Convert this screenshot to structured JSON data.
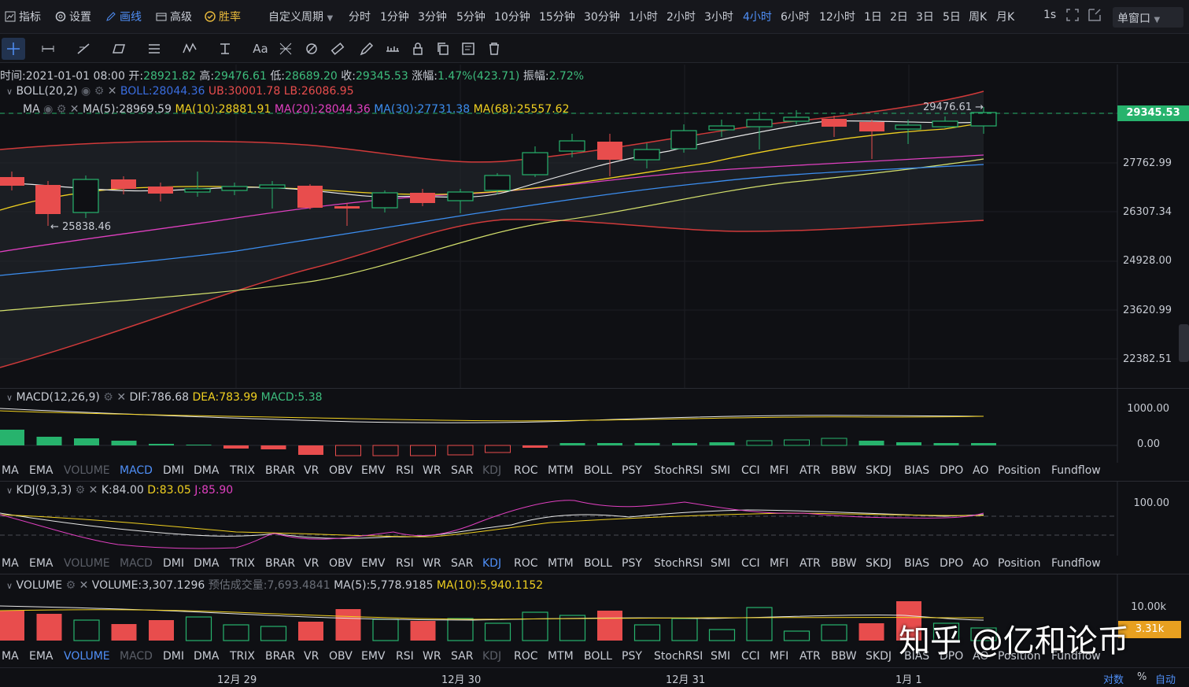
{
  "topbar": {
    "items": [
      {
        "label": "指标",
        "icon": "chart-icon"
      },
      {
        "label": "设置",
        "icon": "gear-icon"
      },
      {
        "label": "画线",
        "icon": "pen-icon",
        "active": true
      },
      {
        "label": "高级",
        "icon": "folder-icon"
      },
      {
        "label": "胜率",
        "icon": "target-icon",
        "gold": true
      }
    ],
    "custom_period": "自定义周期",
    "periods": [
      "分时",
      "1分钟",
      "3分钟",
      "5分钟",
      "10分钟",
      "15分钟",
      "30分钟",
      "1小时",
      "2小时",
      "3小时",
      "4小时",
      "6小时",
      "12小时",
      "1日",
      "2日",
      "3日",
      "5日",
      "周K",
      "月K"
    ],
    "active_period": "4小时",
    "interval_1s": "1s",
    "window_mode": "单窗口"
  },
  "main": {
    "ohlc": {
      "time_label": "时间:",
      "time": "2021-01-01 08:00",
      "open_label": "开:",
      "open": "28921.82",
      "high_label": "高:",
      "high": "29476.61",
      "low_label": "低:",
      "low": "28689.20",
      "close_label": "收:",
      "close": "29345.53",
      "change_label": "涨幅:",
      "change": "1.47%(423.71)",
      "amp_label": "振幅:",
      "amp": "2.72%"
    },
    "boll": {
      "name": "BOLL(20,2)",
      "mid": "BOLL:28044.36",
      "ub": "UB:30001.78",
      "lb": "LB:26086.95"
    },
    "ma": {
      "name": "MA",
      "ma5": "MA(5):28969.59",
      "ma10": "MA(10):28881.91",
      "ma20": "MA(20):28044.36",
      "ma30": "MA(30):27731.38",
      "ma68": "MA(68):25557.62"
    },
    "yaxis": [
      "27762.99",
      "26307.34",
      "24928.00",
      "23620.99",
      "22382.51"
    ],
    "current_price": "29345.53",
    "high_marker": "29476.61 →",
    "low_marker": "← 25838.46"
  },
  "macd": {
    "name": "MACD(12,26,9)",
    "dif": "DIF:786.68",
    "dea": "DEA:783.99",
    "macd": "MACD:5.38",
    "yaxis": [
      "1000.00",
      "0.00"
    ]
  },
  "kdj": {
    "name": "KDJ(9,3,3)",
    "k": "K:84.00",
    "d": "D:83.05",
    "j": "J:85.90",
    "yaxis": [
      "100.00"
    ]
  },
  "volume": {
    "name": "VOLUME",
    "vol": "VOLUME:3,307.1296",
    "est_label": "预估成交量:",
    "est": "7,693.4841",
    "ma5": "MA(5):5,778.9185",
    "ma10": "MA(10):5,940.1152",
    "yaxis": [
      "10.00k"
    ],
    "current_tag": "3.31k"
  },
  "indicators": [
    "MA",
    "EMA",
    "VOLUME",
    "MACD",
    "DMI",
    "DMA",
    "TRIX",
    "BRAR",
    "VR",
    "OBV",
    "EMV",
    "RSI",
    "WR",
    "SAR",
    "KDJ",
    "ROC",
    "MTM",
    "BOLL",
    "PSY",
    "StochRSI",
    "SMI",
    "CCI",
    "MFI",
    "ATR",
    "BBW",
    "SKDJ",
    "BIAS",
    "DPO",
    "AO",
    "Position",
    "Fundflow"
  ],
  "dates": [
    "12月 29",
    "12月 30",
    "12月 31",
    "1月 1"
  ],
  "bottom": {
    "log": "对数",
    "pct": "%",
    "auto": "自动"
  },
  "watermark": "知乎 @亿和论币"
}
